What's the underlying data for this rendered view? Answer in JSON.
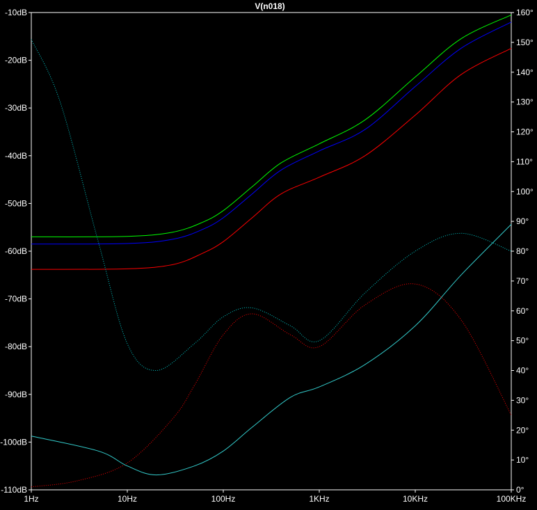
{
  "chart_data": {
    "type": "line",
    "title": "V(n018)",
    "title_color": "#00ff00",
    "background": "#000000",
    "grid": false,
    "x_scale": "log",
    "xlim": [
      1,
      100000
    ],
    "x_ticks": [
      {
        "value": 1,
        "label": "1Hz"
      },
      {
        "value": 10,
        "label": "10Hz"
      },
      {
        "value": 100,
        "label": "100Hz"
      },
      {
        "value": 1000,
        "label": "1KHz"
      },
      {
        "value": 10000,
        "label": "10KHz"
      },
      {
        "value": 100000,
        "label": "100KHz"
      }
    ],
    "y_left": {
      "unit": "dB",
      "ylim": [
        -110,
        -10
      ],
      "ticks": [
        {
          "value": -10,
          "label": "-10dB"
        },
        {
          "value": -20,
          "label": "-20dB"
        },
        {
          "value": -30,
          "label": "-30dB"
        },
        {
          "value": -40,
          "label": "-40dB"
        },
        {
          "value": -50,
          "label": "-50dB"
        },
        {
          "value": -60,
          "label": "-60dB"
        },
        {
          "value": -70,
          "label": "-70dB"
        },
        {
          "value": -80,
          "label": "-80dB"
        },
        {
          "value": -90,
          "label": "-90dB"
        },
        {
          "value": -100,
          "label": "-100dB"
        },
        {
          "value": -110,
          "label": "-110dB"
        }
      ]
    },
    "y_right": {
      "unit": "degrees",
      "ylim": [
        0,
        160
      ],
      "ticks": [
        {
          "value": 160,
          "label": "160°"
        },
        {
          "value": 150,
          "label": "150°"
        },
        {
          "value": 140,
          "label": "140°"
        },
        {
          "value": 130,
          "label": "130°"
        },
        {
          "value": 120,
          "label": "120°"
        },
        {
          "value": 110,
          "label": "110°"
        },
        {
          "value": 100,
          "label": "100°"
        },
        {
          "value": 90,
          "label": "90°"
        },
        {
          "value": 80,
          "label": "80°"
        },
        {
          "value": 70,
          "label": "70°"
        },
        {
          "value": 60,
          "label": "60°"
        },
        {
          "value": 50,
          "label": "50°"
        },
        {
          "value": 40,
          "label": "40°"
        },
        {
          "value": 30,
          "label": "30°"
        },
        {
          "value": 20,
          "label": "20°"
        },
        {
          "value": 10,
          "label": "10°"
        },
        {
          "value": 0,
          "label": "0°"
        }
      ]
    },
    "series": [
      {
        "axis": "left",
        "style": "solid",
        "color": "#00ff00",
        "x": [
          1,
          10,
          30,
          60,
          100,
          200,
          400,
          1000,
          3000,
          10000,
          30000,
          100000
        ],
        "y": [
          -57,
          -56.9,
          -56,
          -54,
          -51.5,
          -46.5,
          -41.5,
          -37.5,
          -32.5,
          -23.5,
          -15.5,
          -10.5
        ]
      },
      {
        "axis": "left",
        "style": "solid",
        "color": "#0000ff",
        "x": [
          1,
          10,
          30,
          60,
          100,
          200,
          400,
          1000,
          3000,
          10000,
          30000,
          100000
        ],
        "y": [
          -58.5,
          -58.4,
          -57.5,
          -55.5,
          -53,
          -48,
          -43,
          -39,
          -34.5,
          -25.5,
          -17.5,
          -12
        ]
      },
      {
        "axis": "left",
        "style": "solid",
        "color": "#ff0000",
        "x": [
          1,
          10,
          30,
          60,
          100,
          200,
          400,
          1000,
          3000,
          10000,
          30000,
          100000
        ],
        "y": [
          -63.8,
          -63.7,
          -62.8,
          -60.5,
          -58,
          -53,
          -48,
          -44.5,
          -40,
          -31.5,
          -23,
          -17.5
        ]
      },
      {
        "axis": "right",
        "style": "dotted",
        "color": "#00cccc",
        "x": [
          1,
          2,
          5,
          10,
          20,
          50,
          100,
          200,
          500,
          1000,
          3000,
          10000,
          30000,
          100000
        ],
        "y": [
          151,
          130,
          83,
          49,
          40,
          49,
          58,
          61,
          55,
          50,
          66,
          80,
          86,
          80
        ]
      },
      {
        "axis": "right",
        "style": "dotted",
        "color": "#ff0000",
        "x": [
          1,
          3,
          10,
          30,
          50,
          100,
          200,
          500,
          1000,
          3000,
          10000,
          30000,
          100000
        ],
        "y": [
          1,
          3,
          9,
          24,
          35,
          52,
          59,
          52,
          48,
          62,
          69,
          57,
          25
        ]
      },
      {
        "axis": "right",
        "style": "solid",
        "color": "#33cccc",
        "x": [
          1,
          5,
          10,
          20,
          50,
          100,
          200,
          500,
          1000,
          3000,
          10000,
          30000,
          100000
        ],
        "y": [
          18,
          13,
          8,
          5,
          8,
          13,
          21,
          31,
          34.5,
          42,
          55,
          72,
          89
        ]
      }
    ]
  }
}
